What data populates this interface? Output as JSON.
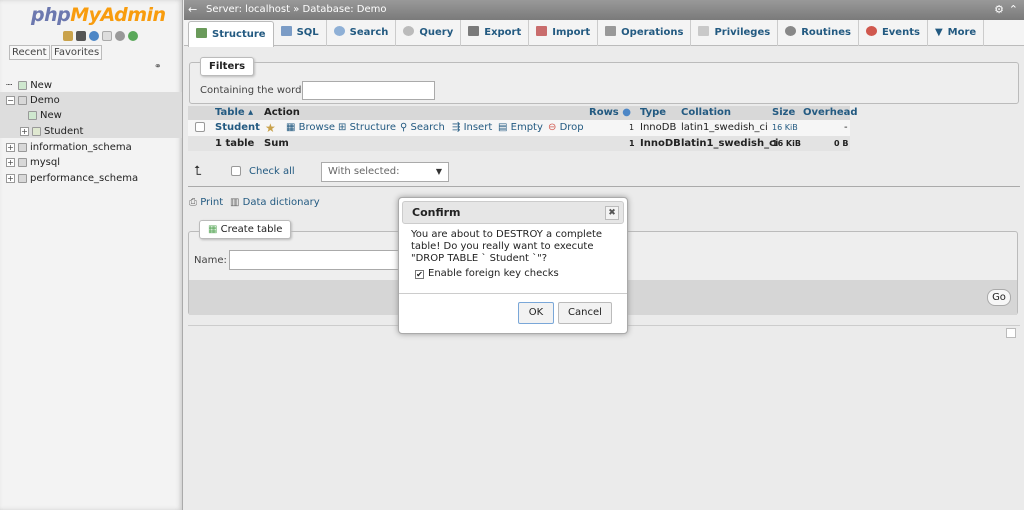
{
  "sidebar": {
    "logo_a": "php",
    "logo_b": "MyAdmin",
    "recent": "Recent",
    "favorites": "Favorites",
    "tree": {
      "new_root": "New",
      "demo": "Demo",
      "new_child": "New",
      "student": "Student",
      "information_schema": "information_schema",
      "mysql": "mysql",
      "performance_schema": "performance_schema"
    }
  },
  "topbar": {
    "breadcrumb": "Server: localhost » Database: Demo"
  },
  "tabs": [
    {
      "label": "Structure"
    },
    {
      "label": "SQL"
    },
    {
      "label": "Search"
    },
    {
      "label": "Query"
    },
    {
      "label": "Export"
    },
    {
      "label": "Import"
    },
    {
      "label": "Operations"
    },
    {
      "label": "Privileges"
    },
    {
      "label": "Routines"
    },
    {
      "label": "Events"
    },
    {
      "label": "More"
    }
  ],
  "filters": {
    "legend": "Filters",
    "label": "Containing the word:",
    "value": ""
  },
  "table": {
    "headers": {
      "table": "Table",
      "action": "Action",
      "rows": "Rows",
      "type": "Type",
      "collation": "Collation",
      "size": "Size",
      "overhead": "Overhead"
    },
    "row": {
      "name": "Student",
      "browse": "Browse",
      "structure": "Structure",
      "search": "Search",
      "insert": "Insert",
      "empty": "Empty",
      "drop": "Drop",
      "rows": "1",
      "type": "InnoDB",
      "collation": "latin1_swedish_ci",
      "size": "16 KiB",
      "overhead": "-"
    },
    "sum": {
      "name": "1 table",
      "label": "Sum",
      "rows": "1",
      "type": "InnoDB",
      "collation": "latin1_swedish_ci",
      "size": "16 KiB",
      "overhead": "0 B"
    }
  },
  "bulk": {
    "check_all": "Check all",
    "with_selected": "With selected:"
  },
  "links": {
    "print": "Print",
    "dictionary": "Data dictionary"
  },
  "create": {
    "legend": "Create table",
    "name_label": "Name:",
    "name_value": "",
    "go": "Go"
  },
  "dialog": {
    "title": "Confirm",
    "message": "You are about to DESTROY a complete table! Do you really want to execute \"DROP TABLE ` Student `\"?",
    "fk": "Enable foreign key checks",
    "ok": "OK",
    "cancel": "Cancel"
  },
  "colors": {
    "link": "#235a81",
    "logo_blue": "#6c78af",
    "logo_orange": "#f89c0e"
  }
}
